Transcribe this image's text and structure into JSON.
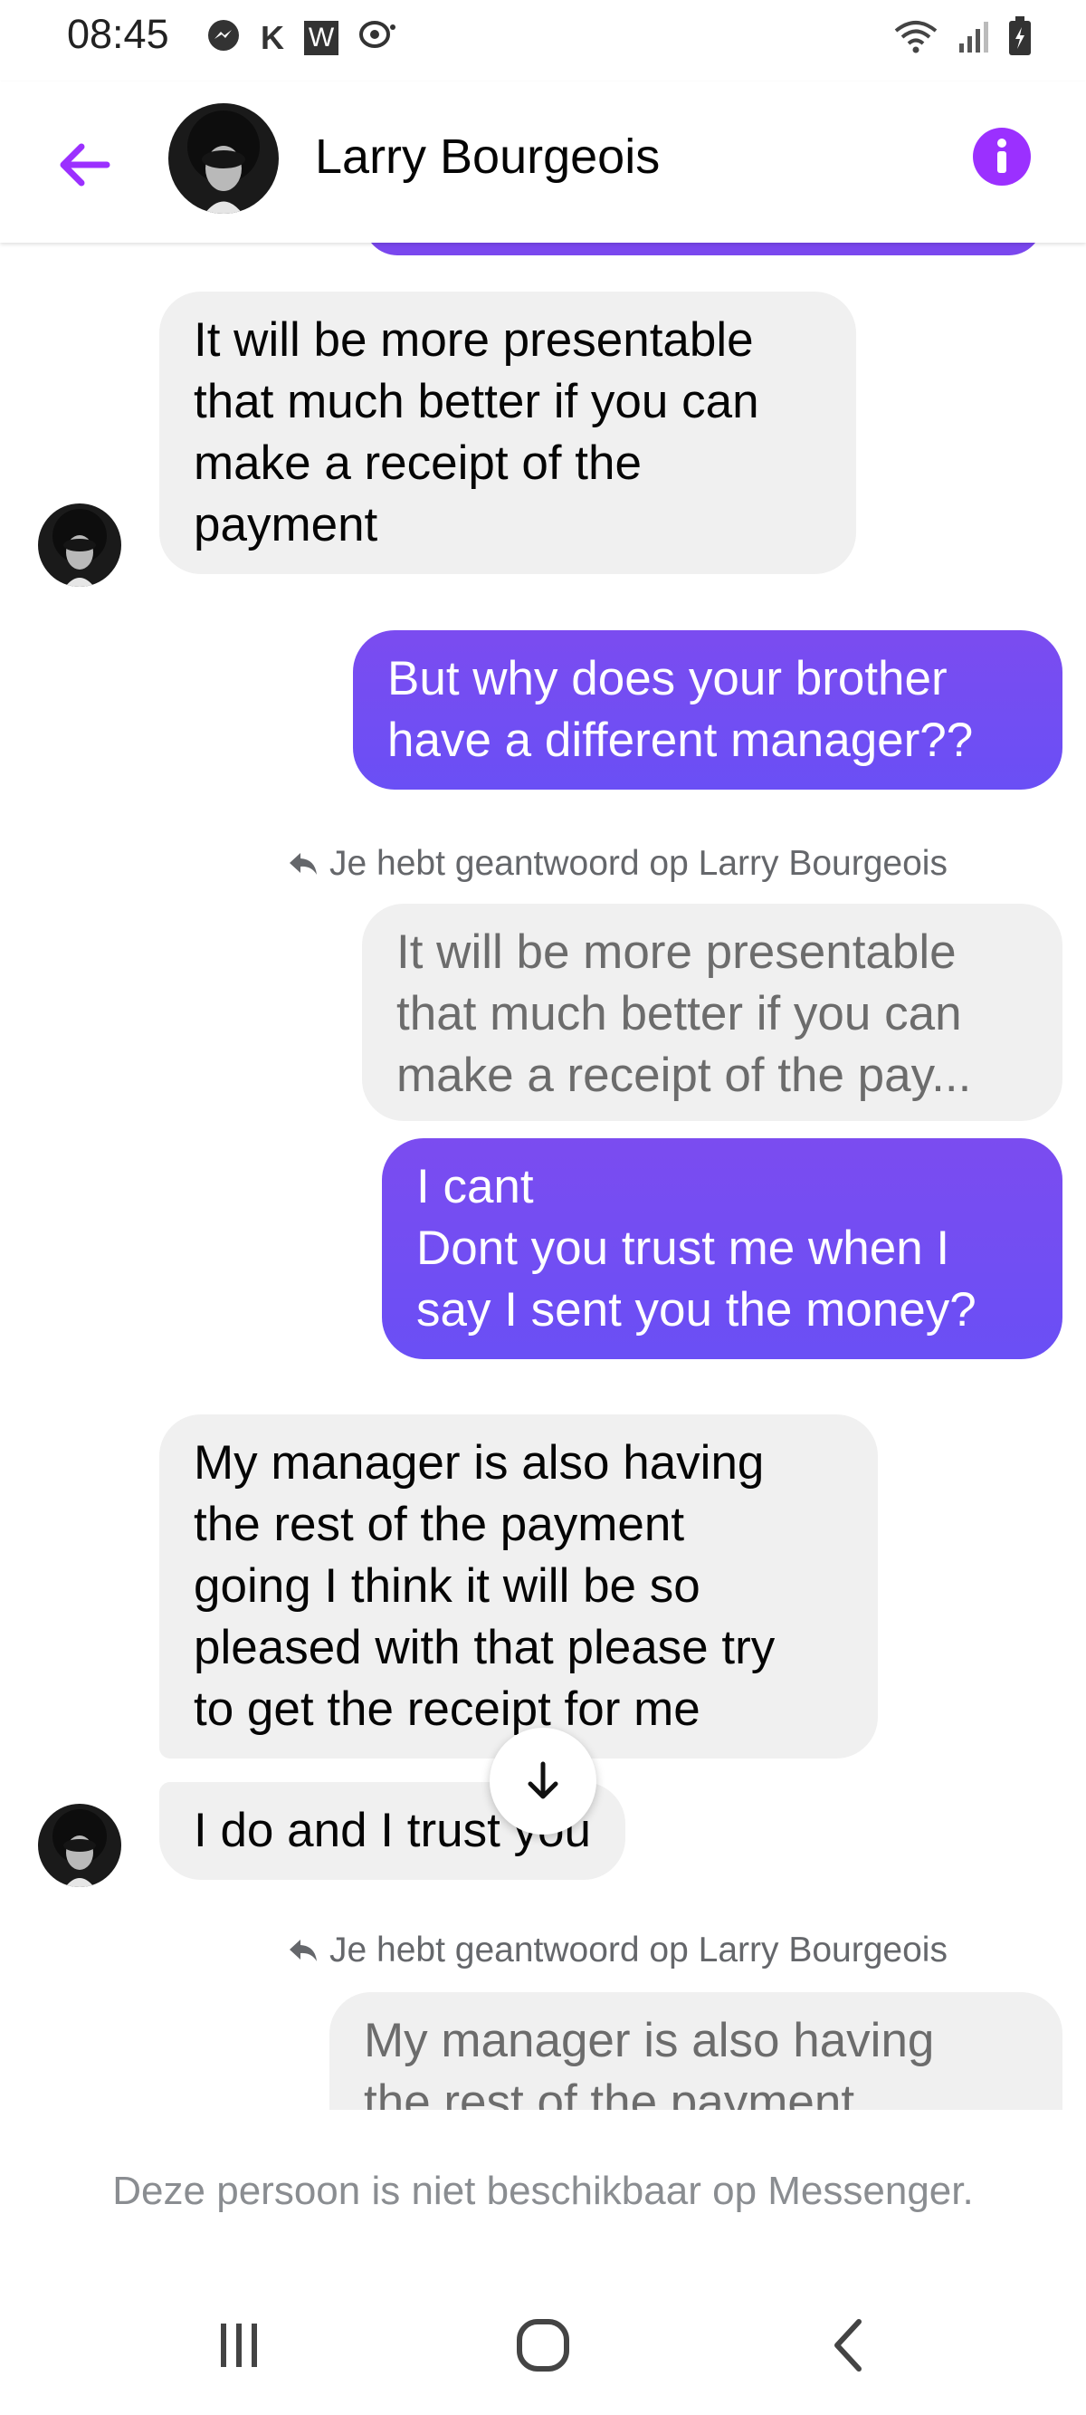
{
  "status_bar": {
    "time": "08:45",
    "left_icons": [
      "messenger-icon",
      "k-icon",
      "w-icon",
      "chat-icon"
    ],
    "right_icons": [
      "wifi-icon",
      "signal-icon",
      "battery-icon"
    ],
    "k_label": "K",
    "w_label": "W"
  },
  "header": {
    "contact_name": "Larry Bourgeois",
    "accent_color": "#9b30ff"
  },
  "messages": [
    {
      "direction": "incoming",
      "lines": [
        "It will be more presentable",
        "that much better if you can",
        "make a receipt of the",
        "payment"
      ]
    },
    {
      "direction": "outgoing",
      "lines": [
        "But why does your brother",
        "have a different manager??"
      ]
    },
    {
      "direction": "outgoing-reply",
      "reply_note": "Je hebt geantwoord op Larry Bourgeois",
      "quoted_lines": [
        "It will be more presentable",
        "that much better if you can",
        "make a receipt of the pay..."
      ],
      "lines": [
        "I cant",
        "Dont you trust me when I",
        "say I sent you the money?"
      ]
    },
    {
      "direction": "incoming",
      "lines": [
        "My manager is also having",
        "the rest of the payment",
        "going I think it will be so",
        "pleased with that please try",
        "to get the receipt for me"
      ]
    },
    {
      "direction": "incoming",
      "lines": [
        "I do and I trust you"
      ]
    },
    {
      "direction": "outgoing-reply",
      "reply_note": "Je hebt geantwoord op Larry Bourgeois",
      "quoted_lines": [
        "My manager is also having",
        "the rest of the payment"
      ]
    }
  ],
  "footer": {
    "unavailable_text": "Deze persoon is niet beschikbaar op Messenger."
  },
  "nav": {
    "icons": [
      "recent-apps-icon",
      "home-icon",
      "back-icon"
    ]
  },
  "colors": {
    "outgoing_bubble": "#6a4ff5",
    "incoming_bubble": "#f0f0f0",
    "accent": "#9b30ff"
  }
}
